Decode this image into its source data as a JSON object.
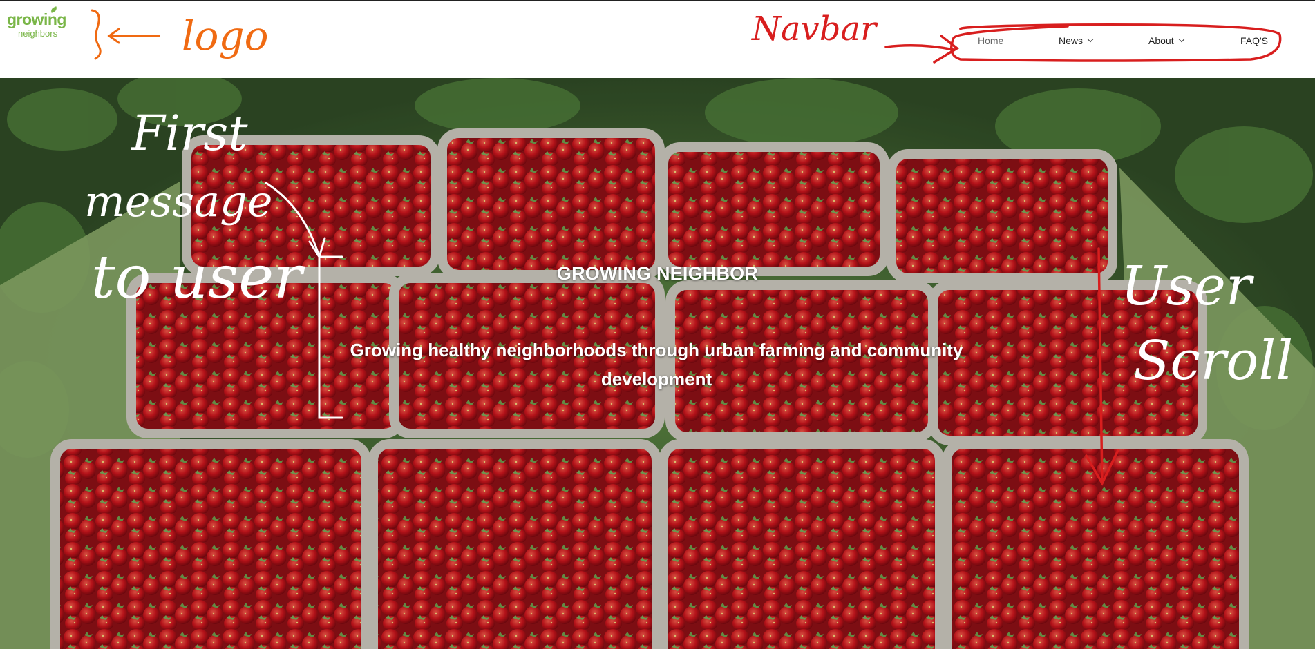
{
  "logo": {
    "line1": "growing",
    "line2": "neighbors"
  },
  "nav": {
    "items": [
      {
        "label": "Home",
        "active": true,
        "has_dropdown": false
      },
      {
        "label": "News",
        "active": false,
        "has_dropdown": true
      },
      {
        "label": "About",
        "active": false,
        "has_dropdown": true
      },
      {
        "label": "FAQ'S",
        "active": false,
        "has_dropdown": false
      }
    ]
  },
  "hero": {
    "title": "GROWING NEIGHBOR",
    "subtitle": "Growing healthy neighborhoods through urban farming and community development"
  },
  "annotations": {
    "logo_note": "logo",
    "navbar_note": "Navbar",
    "first_message_line1": "First",
    "first_message_line2": "message",
    "first_message_line3": "to user",
    "scroll_line1": "User",
    "scroll_line2": "Scroll"
  },
  "colors": {
    "brand_green": "#7ab648",
    "annotation_orange": "#f06a12",
    "annotation_red": "#d81e1e",
    "annotation_white": "#ffffff"
  }
}
